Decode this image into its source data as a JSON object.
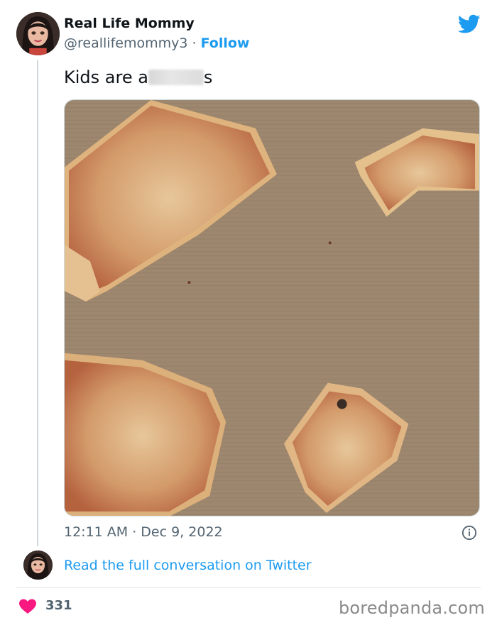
{
  "author": {
    "name": "Real Life Mommy",
    "handle": "@reallifemommy3",
    "separator": " · ",
    "follow_label": "Follow"
  },
  "tweet": {
    "text_before": "Kids are a",
    "text_after": "s",
    "timestamp": "12:11 AM · Dec 9, 2022"
  },
  "conversation_link": "Read the full conversation on Twitter",
  "likes": "331",
  "watermark": "boredpanda.com",
  "colors": {
    "twitter_blue": "#1d9bf0",
    "heart": "#f91880",
    "text_secondary": "#536471",
    "cardboard": "#a08b72"
  },
  "icons": {
    "brand": "twitter-bird-icon",
    "info": "info-icon",
    "like": "heart-icon"
  }
}
